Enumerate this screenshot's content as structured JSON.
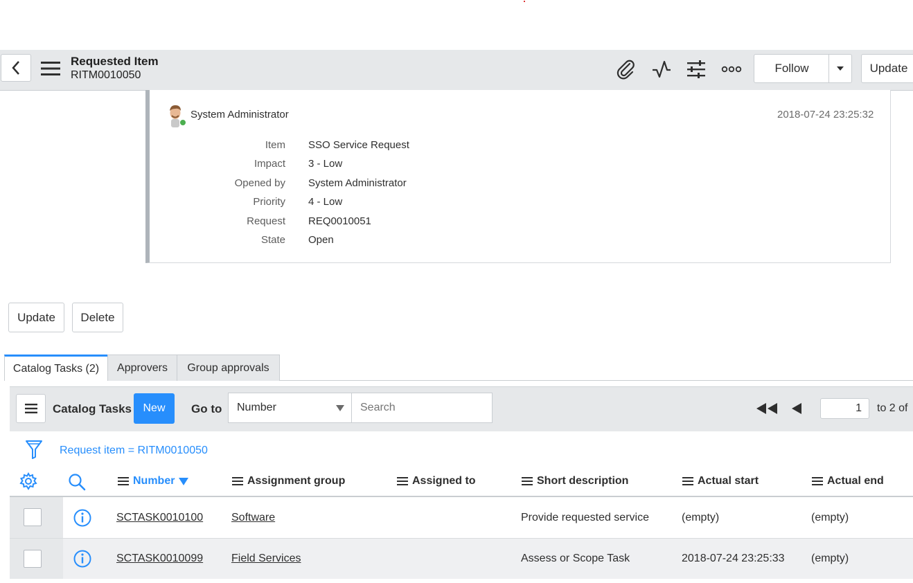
{
  "header": {
    "record_type": "Requested Item",
    "record_number": "RITM0010050",
    "follow_label": "Follow",
    "update_label": "Update"
  },
  "activity": {
    "author": "System Administrator",
    "timestamp": "2018-07-24 23:25:32",
    "fields": [
      {
        "label": "Item",
        "value": "SSO Service Request"
      },
      {
        "label": "Impact",
        "value": "3 - Low"
      },
      {
        "label": "Opened by",
        "value": "System Administrator"
      },
      {
        "label": "Priority",
        "value": "4 - Low"
      },
      {
        "label": "Request",
        "value": "REQ0010051"
      },
      {
        "label": "State",
        "value": "Open"
      }
    ]
  },
  "form_buttons": {
    "update_label": "Update",
    "delete_label": "Delete"
  },
  "tabs": [
    {
      "label": "Catalog Tasks (2)",
      "active": true
    },
    {
      "label": "Approvers",
      "active": false
    },
    {
      "label": "Group approvals",
      "active": false
    }
  ],
  "list": {
    "title": "Catalog Tasks",
    "new_label": "New",
    "goto_label": "Go to",
    "goto_field": "Number",
    "search_placeholder": "Search",
    "page_value": "1",
    "page_suffix": "to 2 of",
    "filter_text": "Request item = RITM0010050",
    "columns": [
      "Number",
      "Assignment group",
      "Assigned to",
      "Short description",
      "Actual start",
      "Actual end"
    ],
    "rows": [
      {
        "number": "SCTASK0010100",
        "assignment_group": "Software",
        "assigned_to": "",
        "short_description": "Provide requested service",
        "actual_start": "(empty)",
        "actual_end": "(empty)"
      },
      {
        "number": "SCTASK0010099",
        "assignment_group": "Field Services",
        "assigned_to": "",
        "short_description": "Assess or Scope Task",
        "actual_start": "2018-07-24 23:25:33",
        "actual_end": "(empty)"
      }
    ]
  },
  "colors": {
    "accent": "#278efc",
    "header_bg": "#e6e8ea",
    "online": "#4caf50"
  }
}
